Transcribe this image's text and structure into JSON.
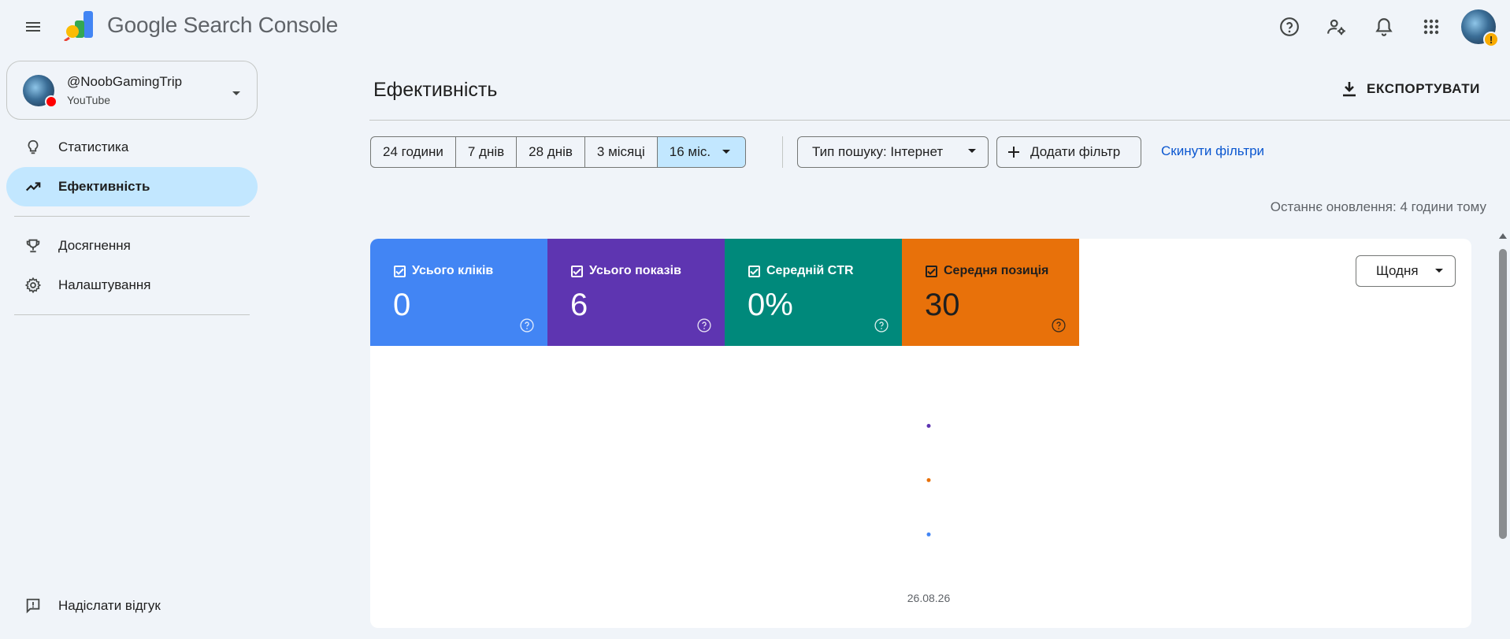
{
  "app": {
    "title": "Google Search Console"
  },
  "property": {
    "name": "@NoobGamingTrip",
    "type": "YouTube"
  },
  "nav": {
    "items": [
      {
        "label": "Статистика",
        "icon": "lightbulb-icon",
        "active": false
      },
      {
        "label": "Ефективність",
        "icon": "trending-up-icon",
        "active": true
      },
      {
        "label": "Досягнення",
        "icon": "trophy-icon",
        "active": false
      },
      {
        "label": "Налаштування",
        "icon": "gear-icon",
        "active": false
      }
    ],
    "feedback": "Надіслати відгук"
  },
  "page": {
    "title": "Ефективність",
    "export_label": "ЕКСПОРТУВАТИ",
    "last_updated": "Останнє оновлення: 4 години тому"
  },
  "filters": {
    "ranges": [
      "24 години",
      "7 днів",
      "28 днів",
      "3 місяці",
      "16 міс."
    ],
    "selected_range": "16 міс.",
    "search_type": "Тип пошуку: Інтернет",
    "add_filter": "Додати фільтр",
    "reset": "Скинути фільтри"
  },
  "metrics": [
    {
      "label": "Усього кліків",
      "value": "0",
      "checked": true,
      "color": "#4285f4"
    },
    {
      "label": "Усього показів",
      "value": "6",
      "checked": true,
      "color": "#5e35b1"
    },
    {
      "label": "Середній CTR",
      "value": "0%",
      "checked": true,
      "color": "#00897b"
    },
    {
      "label": "Середня позиція",
      "value": "30",
      "checked": true,
      "color": "#e8710a"
    }
  ],
  "granularity": "Щодня",
  "chart_data": {
    "type": "scatter",
    "x": [
      "26.08.26"
    ],
    "series": [
      {
        "name": "Усього показів",
        "color": "#5e35b1",
        "values": [
          6
        ]
      },
      {
        "name": "Середня позиція",
        "color": "#e8710a",
        "values": [
          30
        ]
      },
      {
        "name": "Усього кліків",
        "color": "#4285f4",
        "values": [
          0
        ]
      }
    ],
    "xlabel": "",
    "ylabel": "",
    "grid": false,
    "tick_labels": [
      "26.08.26"
    ]
  }
}
